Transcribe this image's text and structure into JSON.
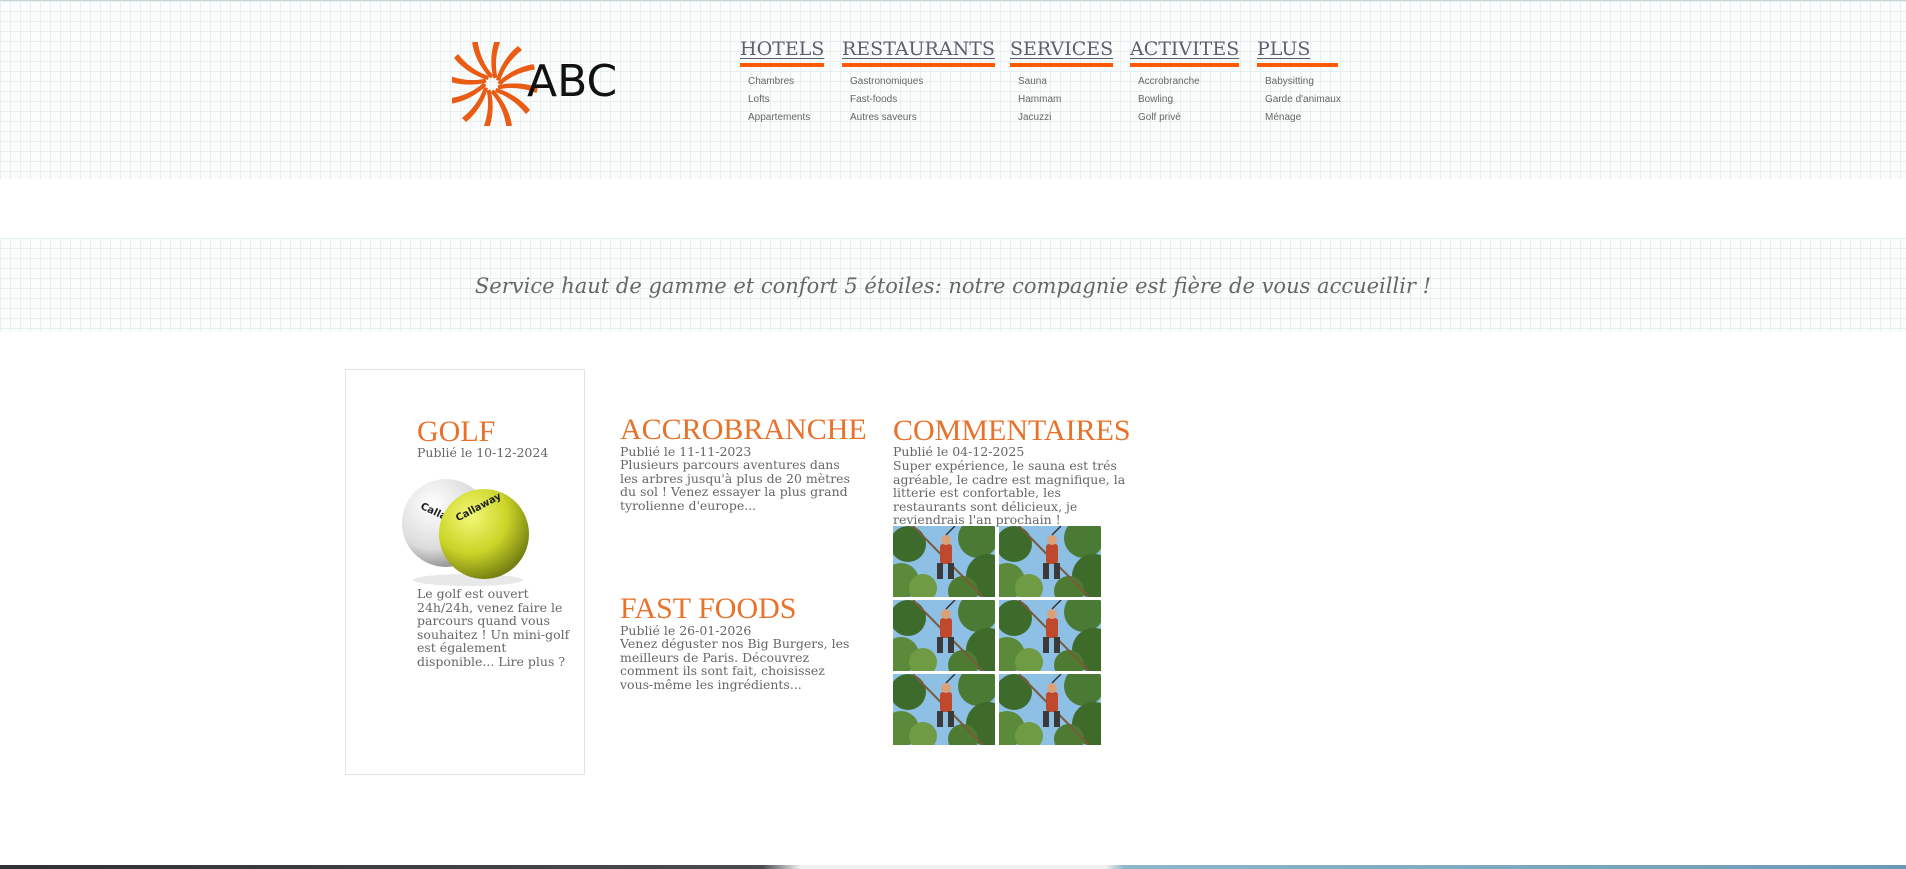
{
  "brand": {
    "logo_text": "ABC",
    "accent": "#e8722a",
    "underline": "#ff5a00"
  },
  "nav": [
    {
      "title": "HOTELS",
      "items": [
        "Chambres",
        "Lofts",
        "Appartements"
      ]
    },
    {
      "title": "RESTAURANTS",
      "items": [
        "Gastronomiques",
        "Fast-foods",
        "Autres saveurs"
      ]
    },
    {
      "title": "SERVICES",
      "items": [
        "Sauna",
        "Hammam",
        "Jacuzzi"
      ]
    },
    {
      "title": "ACTIVITES",
      "items": [
        "Accrobranche",
        "Bowling",
        "Golf privé"
      ]
    },
    {
      "title": "PLUS",
      "items": [
        "Babysitting",
        "Garde d'animaux",
        "Ménage"
      ]
    }
  ],
  "tagline": "Service haut de gamme et confort 5 étoiles: notre compagnie est fière de vous accueillir !",
  "posts": {
    "golf": {
      "title": "GOLF",
      "date": "Publié le 10-12-2024",
      "text_lines": [
        "Le golf est ouvert",
        "24h/24h, venez faire le",
        "parcours quand vous",
        "souhaitez ! Un mini-golf",
        "est également",
        "disponible... Lire plus ?"
      ],
      "image_icon": "golf-balls-image"
    },
    "accrobranche": {
      "title": "ACCROBRANCHE",
      "date": "Publié le 11-11-2023",
      "text_lines": [
        "Plusieurs parcours aventures dans",
        "les arbres jusqu'à plus de 20 mètres",
        "du sol ! Venez essayer la plus grand",
        "tyrolienne d'europe..."
      ]
    },
    "fastfoods": {
      "title": "FAST FOODS",
      "date": "Publié le 26-01-2026",
      "text_lines": [
        "Venez déguster nos Big Burgers, les",
        "meilleurs de Paris. Découvrez",
        "comment ils sont fait, choisissez",
        "vous-même les ingrédients..."
      ]
    },
    "commentaires": {
      "title": "COMMENTAIRES",
      "date": "Publié le 04-12-2025",
      "text_lines": [
        "Super expérience, le sauna est trés",
        "agréable, le cadre est magnifique, la",
        "litterie est confortable, les",
        "restaurants sont délicieux, je",
        "reviendrais l'an prochain !"
      ],
      "gallery_icon": "treetop-adventure-photo"
    }
  }
}
